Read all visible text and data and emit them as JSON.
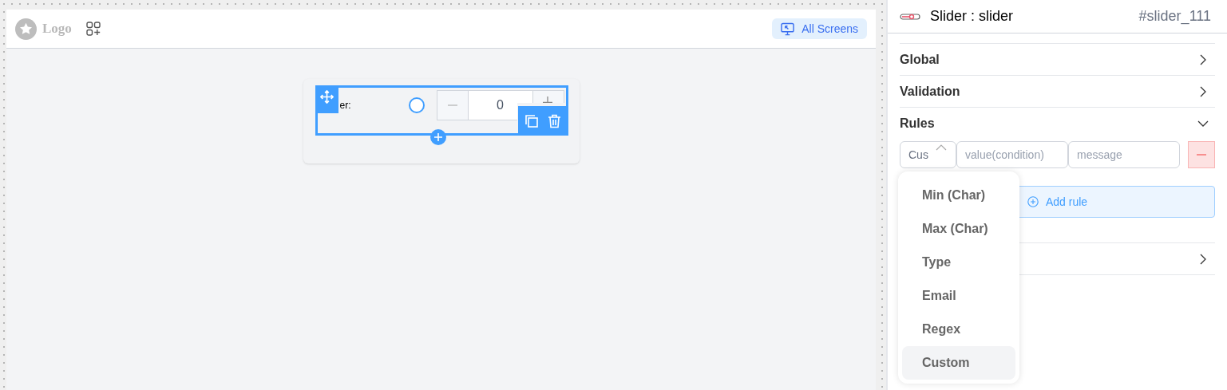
{
  "toolbar": {
    "logo": "Logo",
    "all_screens": "All Screens"
  },
  "canvas": {
    "field_label": "er:",
    "stepper_value": "0"
  },
  "panel": {
    "title": "Slider : slider",
    "id": "#slider_111",
    "sections": [
      {
        "label": "Global",
        "expanded": false
      },
      {
        "label": "Validation",
        "expanded": false
      },
      {
        "label": "Rules",
        "expanded": true
      }
    ],
    "rule": {
      "type_value": "Cus",
      "condition_placeholder": "value(condition)",
      "message_placeholder": "message"
    },
    "add_rule": "Add rule",
    "hidden_section": {
      "expanded": false
    },
    "dropdown": [
      {
        "label": "Min (Char)",
        "selected": false
      },
      {
        "label": "Max (Char)",
        "selected": false
      },
      {
        "label": "Type",
        "selected": false
      },
      {
        "label": "Email",
        "selected": false
      },
      {
        "label": "Regex",
        "selected": false
      },
      {
        "label": "Custom",
        "selected": true
      }
    ]
  }
}
